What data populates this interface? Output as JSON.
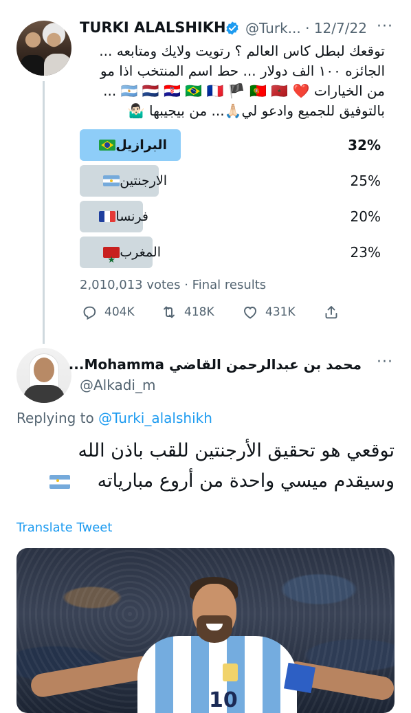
{
  "tweet": {
    "author_name": "TURKI ALALSHIKH",
    "handle": "@Turk...",
    "separator": "·",
    "date": "12/7/22",
    "more": "···",
    "text_lines": [
      "توقعك لبطل كاس العالم ؟ رتويت ولايك ومتابعه ...",
      "الجائزه ١٠٠ الف دولار ... حط اسم المنتخب اذا مو",
      "من الخيارات ❤️ 🇦🇷 🇳🇱 🇭🇷 🇧🇷 🇫🇷 🏴 🇵🇹 🇲🇦 ...",
      "بالتوفيق للجميع وادعو لي🙏🏻... من بيجيبها 🤷🏻‍♂️"
    ],
    "poll": {
      "options": [
        {
          "label": "البرازيل",
          "flag": "flag-br",
          "percent": "32%",
          "fraction": 0.32,
          "winner": true
        },
        {
          "label": "الارجنتين",
          "flag": "flag-ar",
          "percent": "25%",
          "fraction": 0.25,
          "winner": false
        },
        {
          "label": "فرنسا",
          "flag": "flag-fr",
          "percent": "20%",
          "fraction": 0.2,
          "winner": false
        },
        {
          "label": "المغرب",
          "flag": "flag-ma",
          "percent": "23%",
          "fraction": 0.23,
          "winner": false
        }
      ],
      "votes_text": "2,010,013 votes · Final results"
    },
    "actions": {
      "reply_count": "404K",
      "retweet_count": "418K",
      "like_count": "431K"
    }
  },
  "reply": {
    "author_name": "محمد بن عبدالرحمن القاضي Mohamma...",
    "handle": "@Alkadi_m",
    "more": "···",
    "replying_prefix": "Replying to ",
    "replying_handle": "@Turki_alalshikh",
    "text_line1": "توقعي هو تحقيق الأرجنتين للقب باذن الله",
    "text_line2": "وسيقدم ميسي واحدة من أروع مبارياته",
    "translate_label": "Translate Tweet"
  },
  "colors": {
    "link_blue": "#1d9bf0",
    "secondary_text": "#536471",
    "poll_winner": "#8ecdf8",
    "poll_other": "#cfd9de"
  },
  "icons": [
    "verified-badge-icon",
    "reply-icon",
    "retweet-icon",
    "like-icon",
    "share-icon",
    "argentina-flag-icon"
  ]
}
